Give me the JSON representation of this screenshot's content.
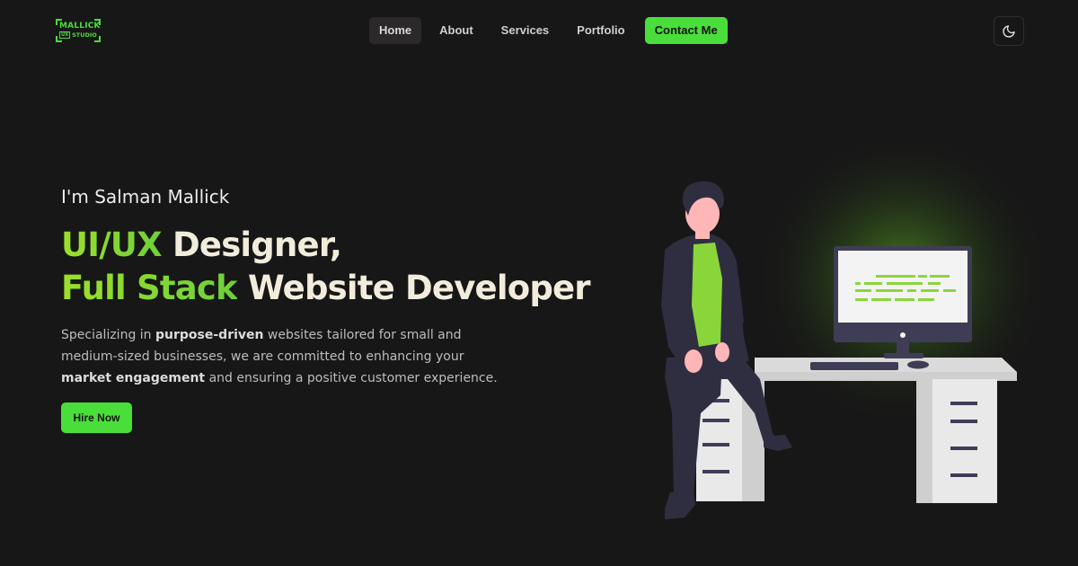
{
  "brand": {
    "logo_top": "MALLICK",
    "logo_box": "UX",
    "logo_bottom": "STUDIO",
    "color": "#4ade3a"
  },
  "nav": {
    "items": [
      {
        "label": "Home",
        "active": true
      },
      {
        "label": "About",
        "active": false
      },
      {
        "label": "Services",
        "active": false
      },
      {
        "label": "Portfolio",
        "active": false
      }
    ],
    "cta": "Contact Me"
  },
  "theme_toggle": {
    "icon": "moon-icon"
  },
  "hero": {
    "intro": "I'm Salman Mallick",
    "line1_highlight": "UI/UX",
    "line1_rest": " Designer,",
    "line2_highlight": "Full Stack",
    "line2_rest": " Website Developer",
    "desc_1": "Specializing in ",
    "desc_b1": "purpose-driven",
    "desc_2": " websites tailored for small and medium-sized businesses, we are committed to enhancing your ",
    "desc_b2": "market engagement",
    "desc_3": " and ensuring a positive customer experience.",
    "cta": "Hire Now"
  },
  "colors": {
    "background": "#171717",
    "accent": "#4ade3a",
    "heading_text": "#f2ecdc",
    "muted_text": "#bdbdbd"
  }
}
